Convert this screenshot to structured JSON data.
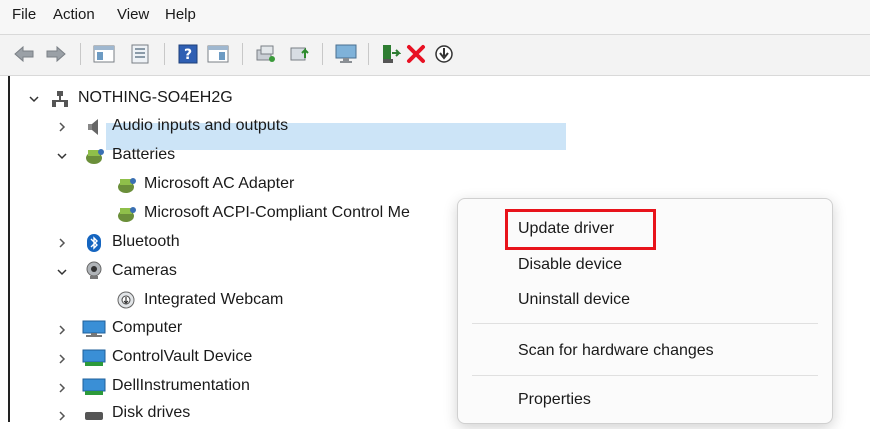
{
  "menubar": {
    "items": [
      "File",
      "Action",
      "View",
      "Help"
    ]
  },
  "toolbar": {
    "buttons": [
      "back-icon",
      "forward-icon",
      "console-tree-icon",
      "properties-icon",
      "help-icon",
      "action-pane-icon",
      "scan-changes-icon",
      "update-driver-icon",
      "monitor-icon",
      "enable-device-icon",
      "uninstall-icon",
      "disable-device-icon"
    ]
  },
  "tree": {
    "root": "NOTHING-SO4EH2G",
    "audio": "Audio inputs and outputs",
    "batteries": "Batteries",
    "ac_adapter": "Microsoft AC Adapter",
    "acpi": "Microsoft ACPI-Compliant Control Me",
    "bluetooth": "Bluetooth",
    "cameras": "Cameras",
    "webcam": "Integrated Webcam",
    "computer": "Computer",
    "controlvault": "ControlVault Device",
    "dellinstr": "DellInstrumentation",
    "disk": "Disk drives"
  },
  "context_menu": {
    "update": "Update driver",
    "disable": "Disable device",
    "uninstall": "Uninstall device",
    "scan": "Scan for hardware changes",
    "properties": "Properties"
  },
  "colors": {
    "selection": "#cce4f7",
    "highlight": "#e8131b",
    "uninstall_red": "#e81123"
  }
}
